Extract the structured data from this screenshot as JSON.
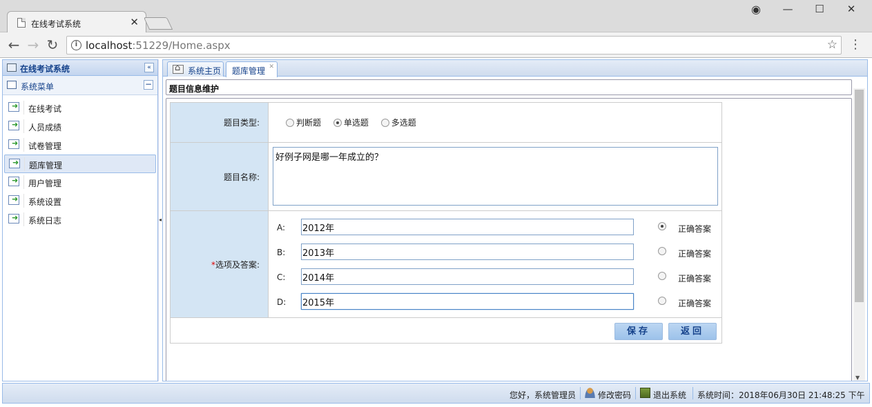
{
  "browser": {
    "tab_title": "在线考试系统",
    "tab_close": "✕",
    "url_host": "localhost",
    "url_rest": ":51229/Home.aspx",
    "info_glyph": "i"
  },
  "app": {
    "west_title": "在线考试系统",
    "menu_title": "系统菜单",
    "menu_items": [
      {
        "label": "在线考试"
      },
      {
        "label": "人员成绩"
      },
      {
        "label": "试卷管理"
      },
      {
        "label": "题库管理"
      },
      {
        "label": "用户管理"
      },
      {
        "label": "系统设置"
      },
      {
        "label": "系统日志"
      }
    ],
    "tabs": [
      {
        "label": "系统主页"
      },
      {
        "label": "题库管理"
      }
    ]
  },
  "form": {
    "panel_title": "题目信息维护",
    "type_label": "题目类型:",
    "type_options": [
      "判断题",
      "单选题",
      "多选题"
    ],
    "type_selected": "单选题",
    "name_label": "题目名称:",
    "name_value": "好例子网是哪一年成立的？",
    "options_label": "选项及答案:",
    "required_mark": "*",
    "correct_label": "正确答案",
    "options": [
      {
        "letter": "A:",
        "value": "2012年",
        "correct": true
      },
      {
        "letter": "B:",
        "value": "2013年",
        "correct": false
      },
      {
        "letter": "C:",
        "value": "2014年",
        "correct": false
      },
      {
        "letter": "D:",
        "value": "2015年",
        "correct": false
      }
    ],
    "save_label": "保存",
    "back_label": "返回"
  },
  "footer": {
    "greeting": "您好，系统管理员",
    "change_password": "修改密码",
    "logout": "退出系统",
    "time_label": "系统时间：",
    "time_value": "2018年06月30日 21:48:25 下午"
  },
  "colors": {
    "accent": "#15428b",
    "label_bg": "#d4e5f4",
    "border": "#99bbe8"
  }
}
